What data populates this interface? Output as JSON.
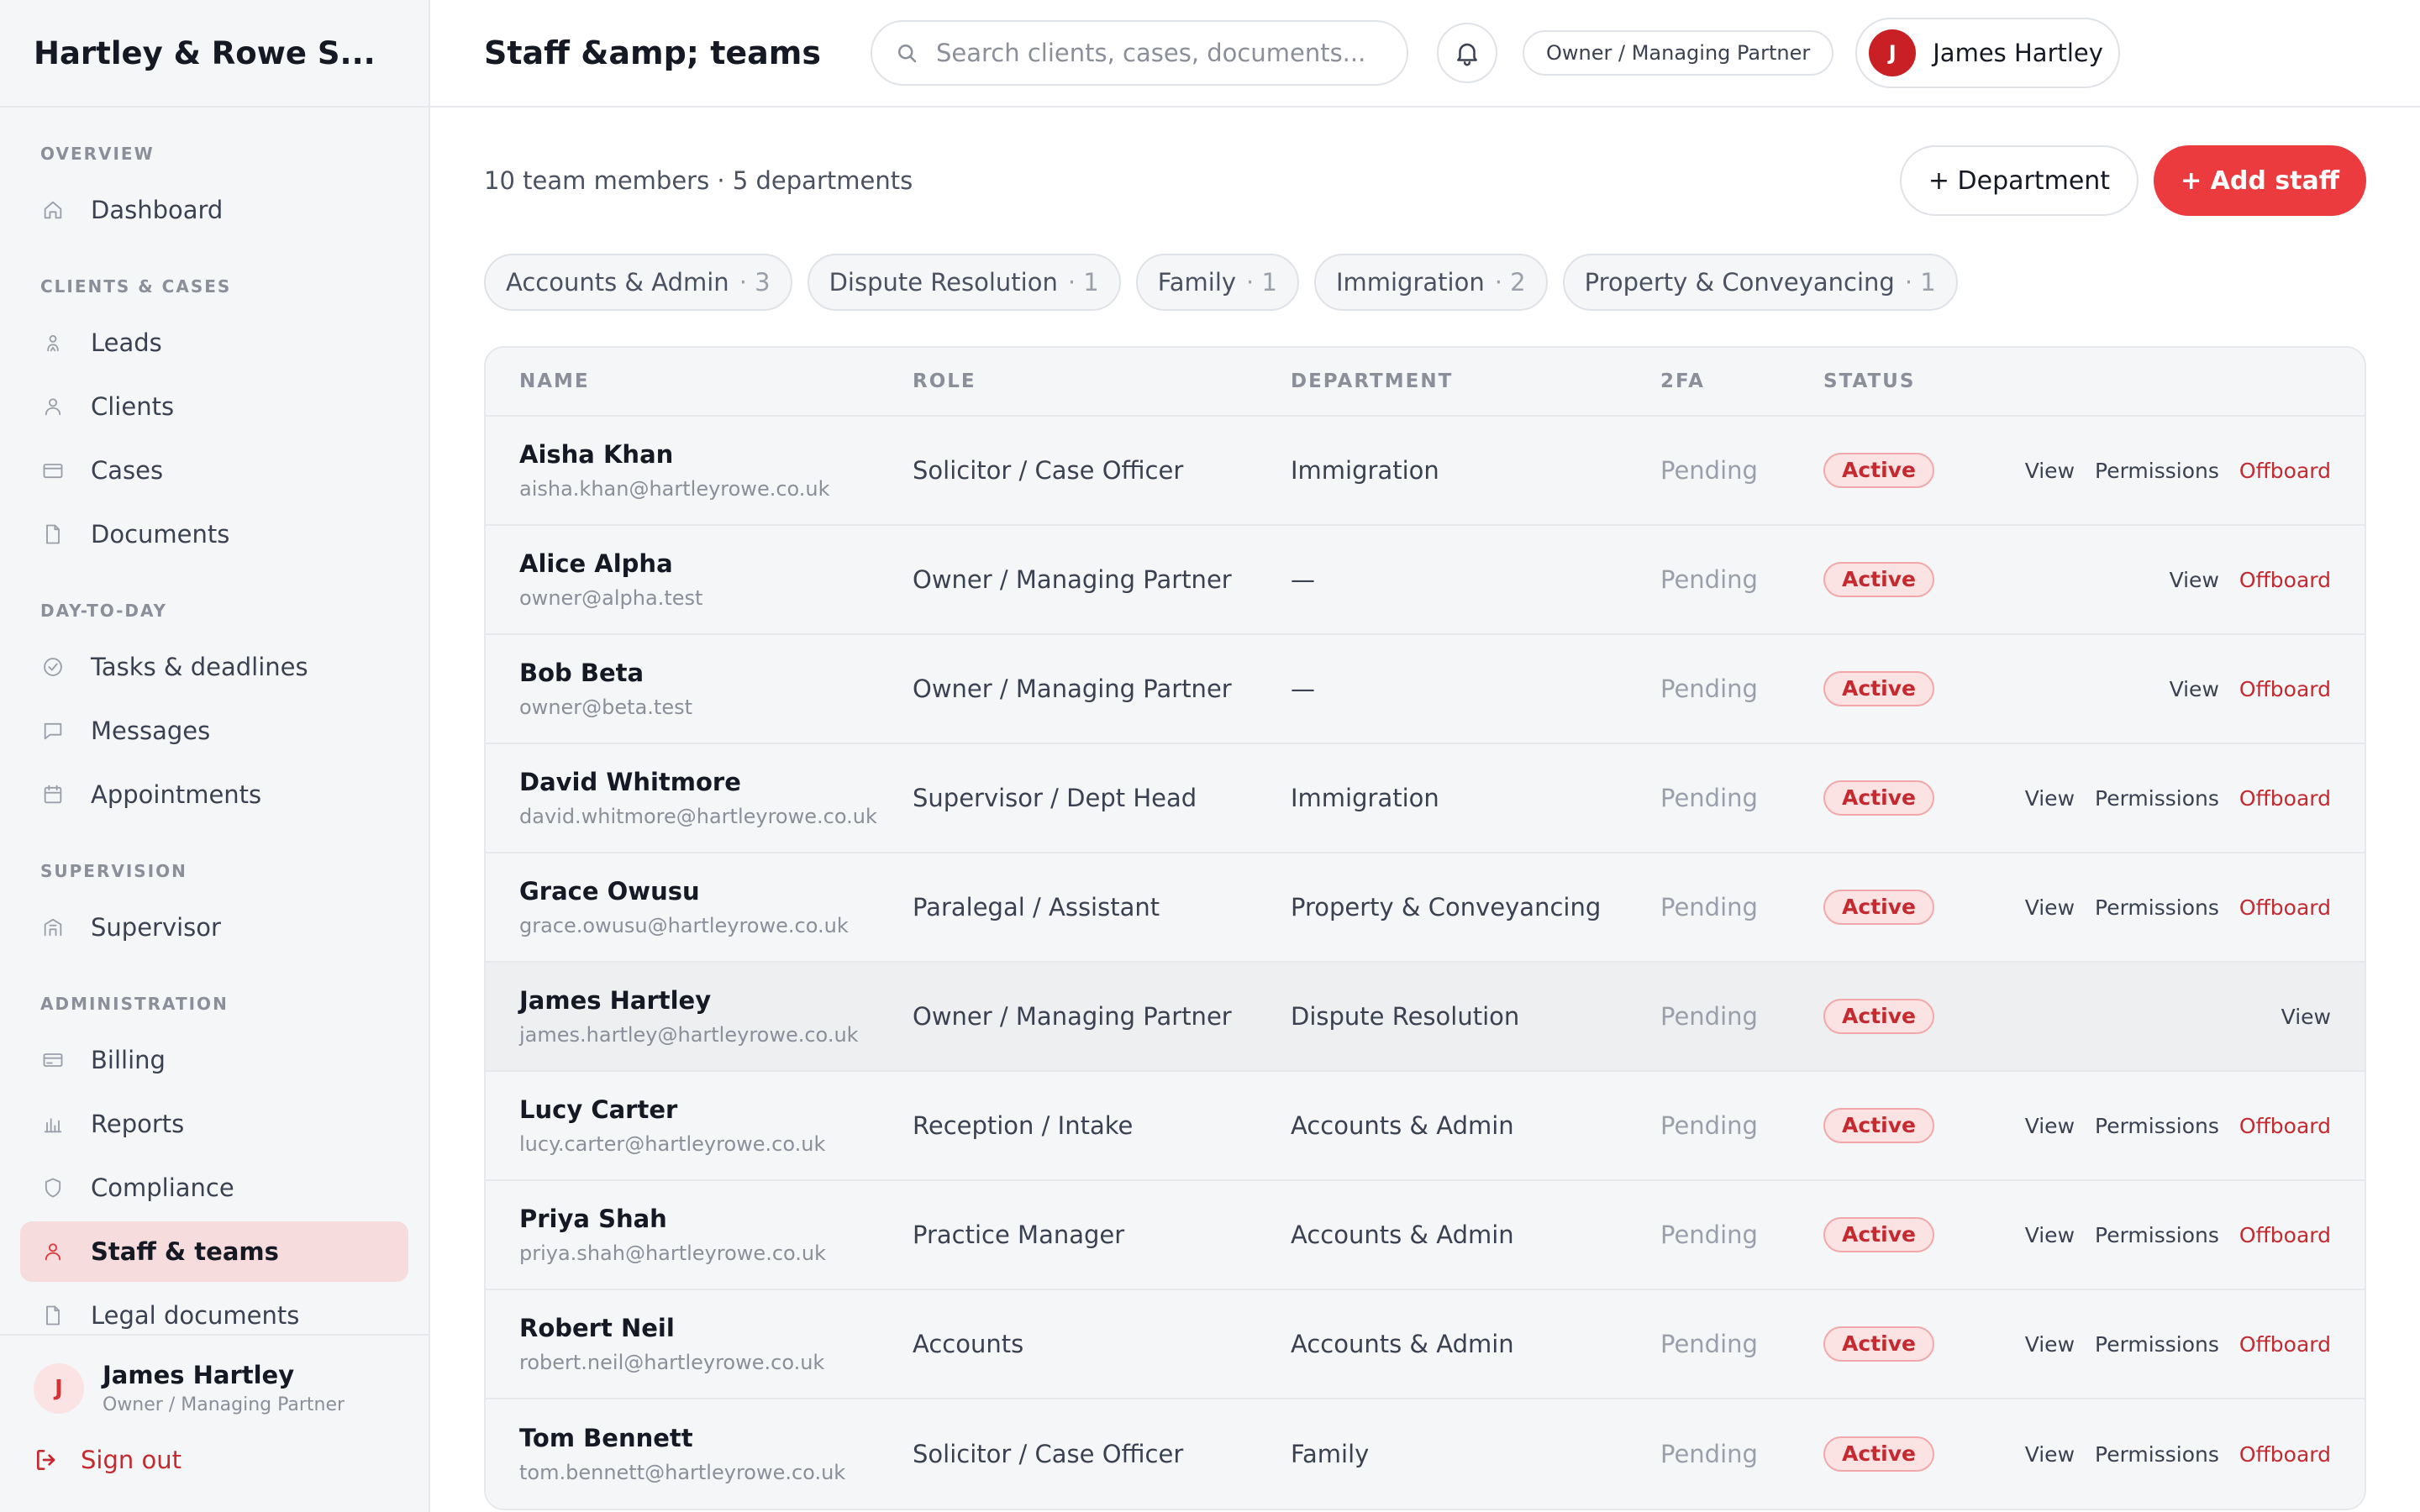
{
  "app": {
    "brand": "Hartley & Rowe S...",
    "page_title": "Staff &amp; teams"
  },
  "sidebar": {
    "sections": [
      {
        "label": "OVERVIEW",
        "items": [
          {
            "label": "Dashboard",
            "icon": "home-icon",
            "active": false
          }
        ]
      },
      {
        "label": "CLIENTS & CASES",
        "items": [
          {
            "label": "Leads",
            "icon": "lead-icon",
            "active": false
          },
          {
            "label": "Clients",
            "icon": "person-icon",
            "active": false
          },
          {
            "label": "Cases",
            "icon": "briefcase-icon",
            "active": false
          },
          {
            "label": "Documents",
            "icon": "document-icon",
            "active": false
          }
        ]
      },
      {
        "label": "DAY-TO-DAY",
        "items": [
          {
            "label": "Tasks & deadlines",
            "icon": "check-circle-icon",
            "active": false
          },
          {
            "label": "Messages",
            "icon": "message-icon",
            "active": false
          },
          {
            "label": "Appointments",
            "icon": "calendar-icon",
            "active": false
          }
        ]
      },
      {
        "label": "SUPERVISION",
        "items": [
          {
            "label": "Supervisor",
            "icon": "building-icon",
            "active": false
          }
        ]
      },
      {
        "label": "ADMINISTRATION",
        "items": [
          {
            "label": "Billing",
            "icon": "card-icon",
            "active": false
          },
          {
            "label": "Reports",
            "icon": "bar-chart-icon",
            "active": false
          },
          {
            "label": "Compliance",
            "icon": "shield-icon",
            "active": false
          },
          {
            "label": "Staff & teams",
            "icon": "person-icon",
            "active": true
          },
          {
            "label": "Legal documents",
            "icon": "document-icon",
            "active": false
          }
        ]
      }
    ],
    "footer": {
      "avatar_initial": "J",
      "name": "James Hartley",
      "role": "Owner / Managing Partner",
      "sign_out": "Sign out"
    }
  },
  "topbar": {
    "search_placeholder": "Search clients, cases, documents...",
    "role_chip": "Owner / Managing Partner",
    "user_initial": "J",
    "user_name": "James Hartley"
  },
  "summary": {
    "text": "10 team members · 5 departments",
    "department_button": "+ Department",
    "add_staff_button": "+ Add staff"
  },
  "department_chips": [
    {
      "name": "Accounts & Admin",
      "count": "· 3"
    },
    {
      "name": "Dispute Resolution",
      "count": "· 1"
    },
    {
      "name": "Family",
      "count": "· 1"
    },
    {
      "name": "Immigration",
      "count": "· 2"
    },
    {
      "name": "Property & Conveyancing",
      "count": "· 1"
    }
  ],
  "table": {
    "headers": {
      "name": "NAME",
      "role": "ROLE",
      "department": "DEPARTMENT",
      "twofa": "2FA",
      "status": "STATUS"
    },
    "rows": [
      {
        "name": "Aisha Khan",
        "email": "aisha.khan@hartleyrowe.co.uk",
        "role": "Solicitor / Case Officer",
        "department": "Immigration",
        "twofa": "Pending",
        "status": "Active",
        "actions": [
          "View",
          "Permissions",
          "Offboard"
        ],
        "highlight": false
      },
      {
        "name": "Alice Alpha",
        "email": "owner@alpha.test",
        "role": "Owner / Managing Partner",
        "department": "—",
        "twofa": "Pending",
        "status": "Active",
        "actions": [
          "View",
          "Offboard"
        ],
        "highlight": false
      },
      {
        "name": "Bob Beta",
        "email": "owner@beta.test",
        "role": "Owner / Managing Partner",
        "department": "—",
        "twofa": "Pending",
        "status": "Active",
        "actions": [
          "View",
          "Offboard"
        ],
        "highlight": false
      },
      {
        "name": "David Whitmore",
        "email": "david.whitmore@hartleyrowe.co.uk",
        "role": "Supervisor / Dept Head",
        "department": "Immigration",
        "twofa": "Pending",
        "status": "Active",
        "actions": [
          "View",
          "Permissions",
          "Offboard"
        ],
        "highlight": false
      },
      {
        "name": "Grace Owusu",
        "email": "grace.owusu@hartleyrowe.co.uk",
        "role": "Paralegal / Assistant",
        "department": "Property & Conveyancing",
        "twofa": "Pending",
        "status": "Active",
        "actions": [
          "View",
          "Permissions",
          "Offboard"
        ],
        "highlight": false
      },
      {
        "name": "James Hartley",
        "email": "james.hartley@hartleyrowe.co.uk",
        "role": "Owner / Managing Partner",
        "department": "Dispute Resolution",
        "twofa": "Pending",
        "status": "Active",
        "actions": [
          "View"
        ],
        "highlight": true
      },
      {
        "name": "Lucy Carter",
        "email": "lucy.carter@hartleyrowe.co.uk",
        "role": "Reception / Intake",
        "department": "Accounts & Admin",
        "twofa": "Pending",
        "status": "Active",
        "actions": [
          "View",
          "Permissions",
          "Offboard"
        ],
        "highlight": false
      },
      {
        "name": "Priya Shah",
        "email": "priya.shah@hartleyrowe.co.uk",
        "role": "Practice Manager",
        "department": "Accounts & Admin",
        "twofa": "Pending",
        "status": "Active",
        "actions": [
          "View",
          "Permissions",
          "Offboard"
        ],
        "highlight": false
      },
      {
        "name": "Robert Neil",
        "email": "robert.neil@hartleyrowe.co.uk",
        "role": "Accounts",
        "department": "Accounts & Admin",
        "twofa": "Pending",
        "status": "Active",
        "actions": [
          "View",
          "Permissions",
          "Offboard"
        ],
        "highlight": false
      },
      {
        "name": "Tom Bennett",
        "email": "tom.bennett@hartleyrowe.co.uk",
        "role": "Solicitor / Case Officer",
        "department": "Family",
        "twofa": "Pending",
        "status": "Active",
        "actions": [
          "View",
          "Permissions",
          "Offboard"
        ],
        "highlight": false
      }
    ]
  },
  "colors": {
    "accent": "#ec3b3f",
    "active_nav_bg": "#f6dcdc",
    "badge_bg": "#fbe3e3",
    "badge_text": "#c42a2f"
  }
}
